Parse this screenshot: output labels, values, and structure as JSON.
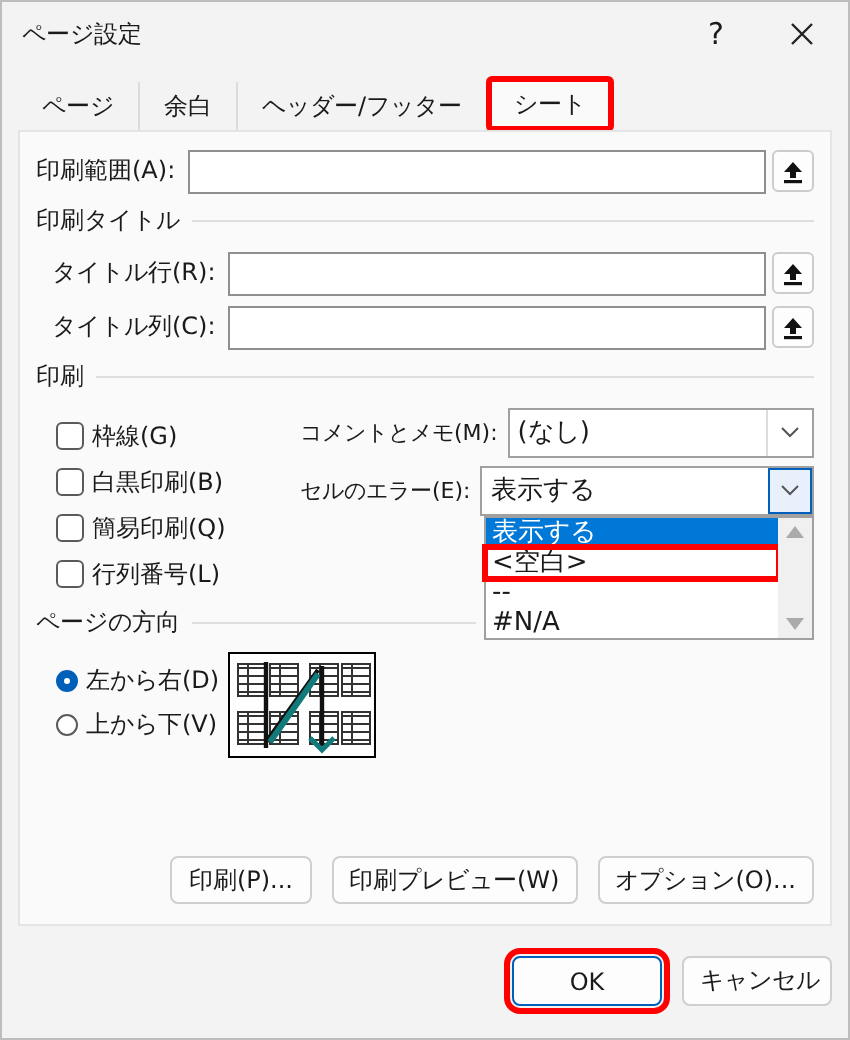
{
  "window": {
    "title": "ページ設定",
    "help": "?"
  },
  "tabs": [
    {
      "label": "ページ",
      "selected": false,
      "highlighted": false
    },
    {
      "label": "余白",
      "selected": false,
      "highlighted": false
    },
    {
      "label": "ヘッダー/フッター",
      "selected": false,
      "highlighted": false
    },
    {
      "label": "シート",
      "selected": true,
      "highlighted": true
    }
  ],
  "print_area": {
    "label": "印刷範囲(A):"
  },
  "print_titles": {
    "heading": "印刷タイトル",
    "rows": [
      {
        "label": "タイトル行(R):"
      },
      {
        "label": "タイトル列(C):"
      }
    ]
  },
  "print": {
    "heading": "印刷",
    "checkboxes": [
      {
        "label": "枠線(G)",
        "checked": false
      },
      {
        "label": "白黒印刷(B)",
        "checked": false
      },
      {
        "label": "簡易印刷(Q)",
        "checked": false
      },
      {
        "label": "行列番号(L)",
        "checked": false
      }
    ],
    "comments": {
      "label": "コメントとメモ(M):",
      "value": "(なし)"
    },
    "cell_errors": {
      "label": "セルのエラー(E):",
      "value": "表示する",
      "expanded": true,
      "options": [
        {
          "label": "表示する",
          "selected": true,
          "highlighted": false
        },
        {
          "label": "<空白>",
          "selected": false,
          "highlighted": true
        },
        {
          "label": "--",
          "selected": false,
          "highlighted": false
        },
        {
          "label": "#N/A",
          "selected": false,
          "highlighted": false
        }
      ]
    }
  },
  "page_order": {
    "heading": "ページの方向",
    "options": [
      {
        "label": "左から右(D)",
        "selected": true
      },
      {
        "label": "上から下(V)",
        "selected": false
      }
    ]
  },
  "buttons": [
    "印刷(P)...",
    "印刷プレビュー(W)",
    "オプション(O)..."
  ],
  "footer_buttons": [
    {
      "label": "OK",
      "default": true,
      "highlighted": true
    },
    {
      "label": "キャンセル",
      "default": false,
      "highlighted": false
    }
  ]
}
